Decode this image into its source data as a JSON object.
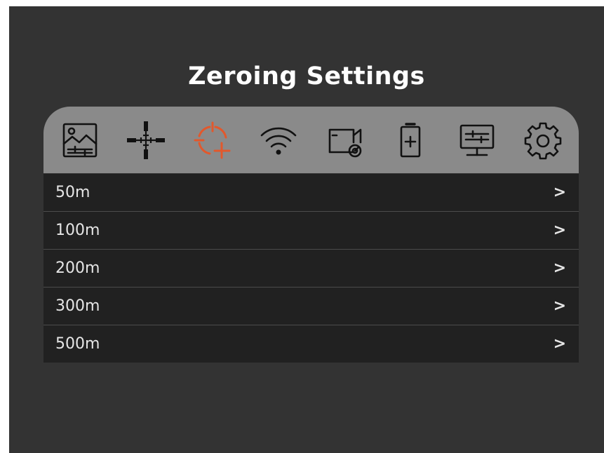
{
  "header": {
    "title": "Zeroing Settings"
  },
  "colors": {
    "active_tab": "#e2582c",
    "icon": "#111111",
    "tabbar_bg": "#8a8a8a",
    "menu_bg": "#212121",
    "screen_bg": "#333333"
  },
  "tabs": [
    {
      "icon": "image-adjust-icon",
      "active": false
    },
    {
      "icon": "reticle-icon",
      "active": false
    },
    {
      "icon": "zeroing-crosshair-icon",
      "active": true
    },
    {
      "icon": "wifi-icon",
      "active": false
    },
    {
      "icon": "video-record-icon",
      "active": false
    },
    {
      "icon": "battery-icon",
      "active": false
    },
    {
      "icon": "display-settings-icon",
      "active": false
    },
    {
      "icon": "gear-icon",
      "active": false
    }
  ],
  "menu": {
    "items": [
      {
        "label": "50m",
        "chevron": ">"
      },
      {
        "label": "100m",
        "chevron": ">"
      },
      {
        "label": "200m",
        "chevron": ">"
      },
      {
        "label": "300m",
        "chevron": ">"
      },
      {
        "label": "500m",
        "chevron": ">"
      }
    ]
  }
}
